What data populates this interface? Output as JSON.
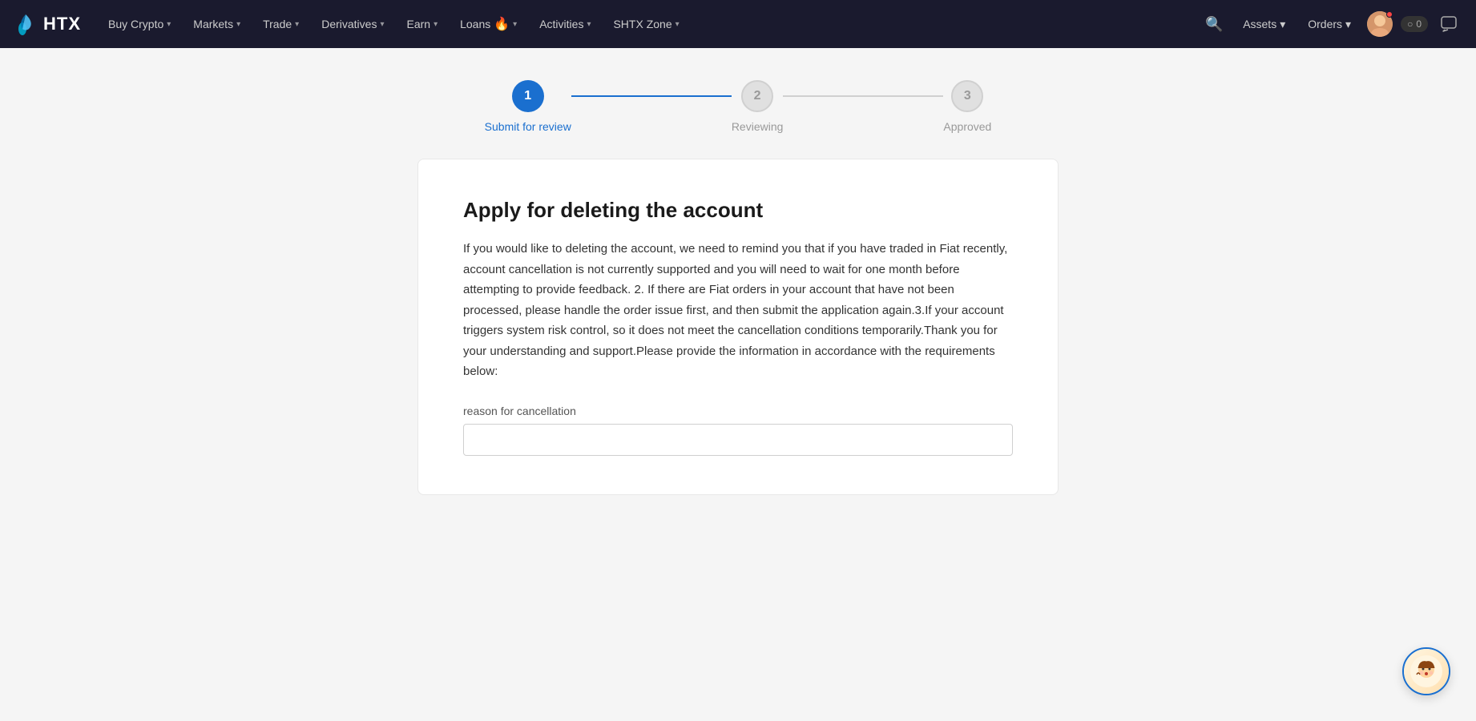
{
  "app": {
    "logo_text": "HTX"
  },
  "navbar": {
    "items": [
      {
        "id": "buy-crypto",
        "label": "Buy Crypto",
        "has_dropdown": true
      },
      {
        "id": "markets",
        "label": "Markets",
        "has_dropdown": true
      },
      {
        "id": "trade",
        "label": "Trade",
        "has_dropdown": true
      },
      {
        "id": "derivatives",
        "label": "Derivatives",
        "has_dropdown": true
      },
      {
        "id": "earn",
        "label": "Earn",
        "has_dropdown": true
      },
      {
        "id": "loans",
        "label": "Loans",
        "has_dropdown": true,
        "has_fire": true
      },
      {
        "id": "activities",
        "label": "Activities",
        "has_dropdown": true
      },
      {
        "id": "shtx-zone",
        "label": "SHTX Zone",
        "has_dropdown": true
      }
    ],
    "assets_label": "Assets",
    "orders_label": "Orders"
  },
  "stepper": {
    "steps": [
      {
        "id": "submit",
        "number": "1",
        "label": "Submit for review",
        "state": "active"
      },
      {
        "id": "reviewing",
        "number": "2",
        "label": "Reviewing",
        "state": "inactive"
      },
      {
        "id": "approved",
        "number": "3",
        "label": "Approved",
        "state": "inactive"
      }
    ]
  },
  "card": {
    "title": "Apply for deleting the account",
    "body": "If you would like to deleting the account, we need to remind you that if you have traded in Fiat recently, account cancellation is not currently supported and you will need to wait for one month before attempting to provide feedback. 2. If there are Fiat orders in your account that have not been processed, please handle the order issue first, and then submit the application again.3.If your account triggers system risk control, so it does not meet the cancellation conditions temporarily.Thank you for your understanding and support.Please provide the information in accordance with the requirements below:",
    "field_label": "reason for cancellation",
    "field_placeholder": ""
  },
  "support": {
    "bubble_emoji": "🤖"
  },
  "icons": {
    "search": "🔍",
    "chevron_down": "▾",
    "fire": "🔥",
    "toggle_off": "○",
    "chat": "💬"
  }
}
